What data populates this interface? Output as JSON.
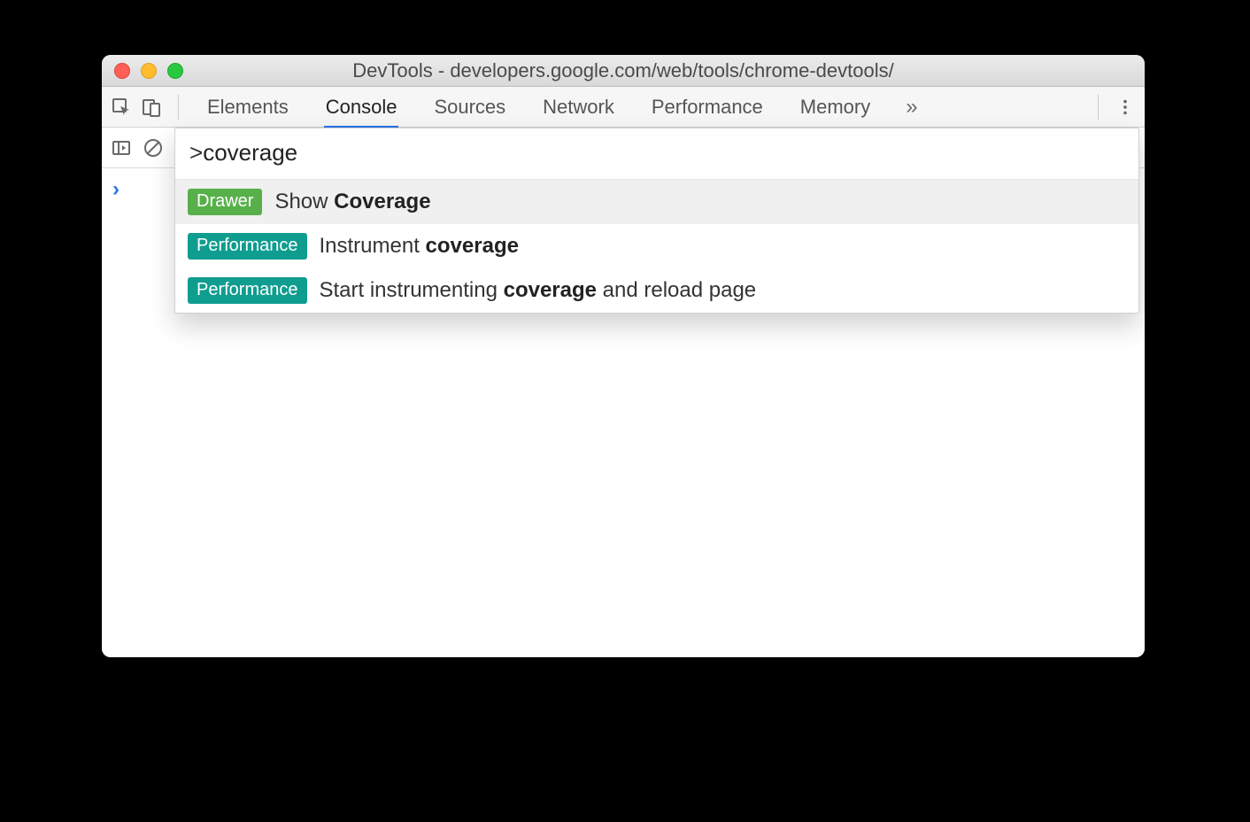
{
  "titlebar": {
    "title": "DevTools - developers.google.com/web/tools/chrome-devtools/"
  },
  "tabs": {
    "items": [
      "Elements",
      "Console",
      "Sources",
      "Network",
      "Performance",
      "Memory"
    ],
    "active": "Console",
    "overflow_glyph": "»"
  },
  "console": {
    "prompt_glyph": "›"
  },
  "command_menu": {
    "prefix": ">",
    "query": "coverage",
    "items": [
      {
        "badge": "Drawer",
        "badge_kind": "drawer",
        "text_pre": "Show ",
        "text_bold": "Coverage",
        "text_post": "",
        "selected": true
      },
      {
        "badge": "Performance",
        "badge_kind": "perf",
        "text_pre": "Instrument ",
        "text_bold": "coverage",
        "text_post": "",
        "selected": false
      },
      {
        "badge": "Performance",
        "badge_kind": "perf",
        "text_pre": "Start instrumenting ",
        "text_bold": "coverage",
        "text_post": " and reload page",
        "selected": false
      }
    ]
  }
}
